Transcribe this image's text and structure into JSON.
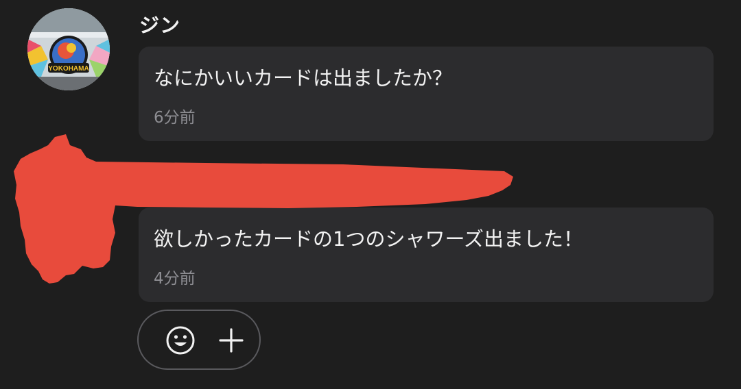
{
  "user": {
    "name": "ジン",
    "avatar_text": "YOKOHAMA"
  },
  "messages": [
    {
      "text": "なにかいいカードは出ましたか？",
      "time": "6分前"
    },
    {
      "text": "欲しかったカードの1つのシャワーズ出ました！",
      "time": "4分前"
    }
  ],
  "actions": {
    "reaction_icon": "smiley-icon",
    "add_icon": "plus-icon"
  },
  "colors": {
    "background": "#1e1e1e",
    "bubble": "#2c2c2e",
    "redaction": "#e84b3c",
    "secondary_text": "#8e8e93"
  }
}
